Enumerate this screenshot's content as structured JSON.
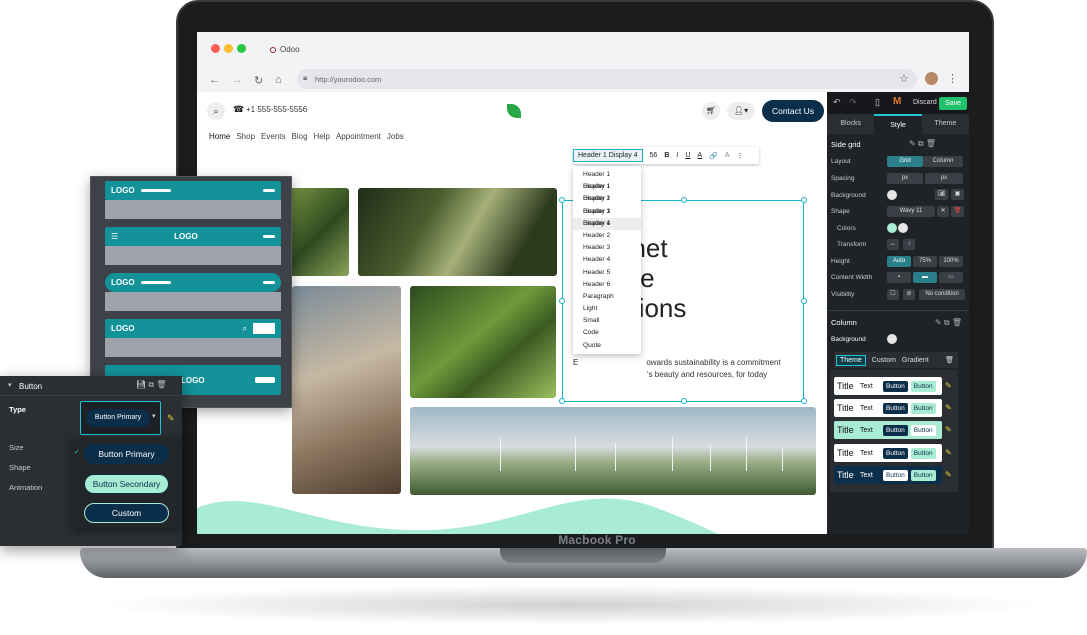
{
  "device": {
    "label": "Macbook Pro"
  },
  "browser": {
    "tab_title": "Odoo",
    "url": "http://yourodoo.com"
  },
  "site": {
    "phone": "+1 555-555-5556",
    "contact_button": "Contact Us",
    "menu": [
      "Home",
      "Shop",
      "Events",
      "Blog",
      "Help",
      "Appointment",
      "Jobs"
    ],
    "headline_lines": [
      "ct",
      "anet",
      "ure",
      "ations"
    ],
    "body_lines": [
      "E",
      "owards sustainability is a commitment",
      "'s beauty and resources, for today"
    ],
    "format_toolbar": {
      "style": "Header 1 Display 4",
      "size": "56",
      "bold": "B",
      "italic": "I",
      "underline": "U",
      "color": "A",
      "link": "🔗",
      "clear": "A",
      "more": "⋮"
    },
    "style_options": [
      "Header 1 Display 1",
      "Header 1 Display 2",
      "Header 1 Display 3",
      "Header 1 Display 4",
      "Header 1",
      "Header 2",
      "Header 3",
      "Header 4",
      "Header 5",
      "Header 6",
      "Paragraph",
      "Light",
      "Small",
      "Code",
      "Quote"
    ],
    "style_selected_index": 4
  },
  "editor": {
    "discard": "Discard",
    "save": "Save",
    "tabs": [
      "Blocks",
      "Style",
      "Theme"
    ],
    "active_tab": "Style",
    "section_side_grid": "Side grid",
    "rows": {
      "layout": "Layout",
      "layout_options": [
        "Grid",
        "Column"
      ],
      "spacing": "Spacing",
      "spacing_unit": "px",
      "background": "Background",
      "shape": "Shape",
      "shape_value": "Wavy 11",
      "colors": "Colors",
      "transform": "Transform",
      "height": "Height",
      "height_options": [
        "Auto",
        "75%",
        "100%"
      ],
      "content_width": "Content Width",
      "visibility": "Visibility",
      "visibility_value": "No condition"
    },
    "section_column": "Column",
    "column_background": "Background",
    "theme_tabs": [
      "Theme",
      "Custom",
      "Gradient"
    ],
    "theme_cards": [
      {
        "title": "Title",
        "text": "Text",
        "b1": "Button",
        "b2": "Button",
        "bg": "#ffffff",
        "b1bg": "#0b2e4a",
        "b2bg": "#a8ecd4"
      },
      {
        "title": "Title",
        "text": "Text",
        "b1": "Button",
        "b2": "Button",
        "bg": "#ffffff",
        "b1bg": "#0b2e4a",
        "b2bg": "#a8ecd4"
      },
      {
        "title": "Title",
        "text": "Text",
        "b1": "Button",
        "b2": "Button",
        "bg": "#a8ecd4",
        "b1bg": "#0b2e4a",
        "b2bg": "#ffffff"
      },
      {
        "title": "Title",
        "text": "Text",
        "b1": "Button",
        "b2": "Button",
        "bg": "#ffffff",
        "b1bg": "#0b2e4a",
        "b2bg": "#a8ecd4"
      },
      {
        "title": "Title",
        "text": "Text",
        "b1": "Button",
        "b2": "Button",
        "bg": "#0b2e4a",
        "b1bg": "#ffffff",
        "b2bg": "#a8ecd4"
      }
    ]
  },
  "header_templates": {
    "logo_label": "LOGO"
  },
  "button_panel": {
    "title": "Button",
    "type_label": "Type",
    "type_value": "Button Primary",
    "size_label": "Size",
    "shape_label": "Shape",
    "animation_label": "Animation",
    "options": [
      "Button Primary",
      "Button Secondary",
      "Custom"
    ]
  },
  "colors": {
    "accent": "#21c6d6",
    "navy": "#0b2e4a",
    "mint": "#a8ecd4",
    "save_green": "#21c06b"
  }
}
